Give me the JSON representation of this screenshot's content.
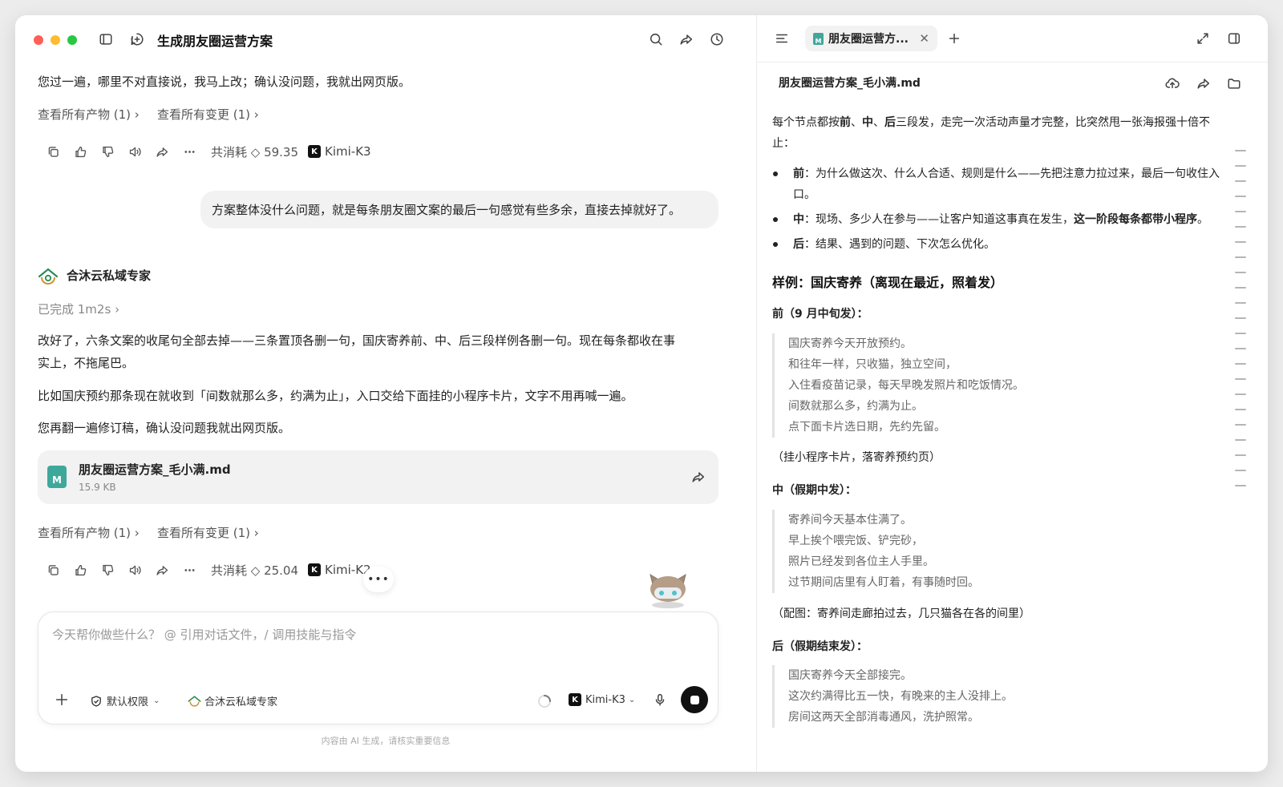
{
  "titlebar": {
    "chat_title": "生成朋友圈运营方案"
  },
  "chat": {
    "intro_line": "您过一遍，哪里不对直接说，我马上改；确认没问题，我就出网页版。",
    "links1": {
      "artifacts": "查看所有产物 (1)",
      "changes": "查看所有变更 (1)"
    },
    "toolbar1": {
      "cost": "共消耗 ◇ 59.35",
      "model": "Kimi-K3"
    },
    "user_message": "方案整体没什么问题，就是每条朋友圈文案的最后一句感觉有些多余，直接去掉就好了。",
    "agent": {
      "name": "合沐云私域专家",
      "status": "已完成 1m2s",
      "para1_line1": "改好了，六条文案的收尾句全部去掉——三条置顶各删一句，国庆寄养前、中、后三段样例各删一句。现在每条都收在事",
      "para1_line2": "实上，不拖尾巴。",
      "para2": "比如国庆预约那条现在就收到「间数就那么多，约满为止」，入口交给下面挂的小程序卡片，文字不用再喊一遍。",
      "para3": "您再翻一遍修订稿，确认没问题我就出网页版。"
    },
    "file_card": {
      "name": "朋友圈运营方案_毛小满.md",
      "size": "15.9 KB",
      "icon_letter": "M"
    },
    "links2": {
      "artifacts": "查看所有产物 (1)",
      "changes": "查看所有变更 (1)"
    },
    "toolbar2": {
      "cost": "共消耗 ◇ 25.04",
      "model": "Kimi-K2"
    },
    "input": {
      "placeholder": "今天帮你做些什么？ @ 引用对话文件，/ 调用技能与指令",
      "permission": "默认权限",
      "agent": "合沐云私域专家",
      "model": "Kimi-K3"
    },
    "disclaimer": "内容由 AI 生成，请核实重要信息"
  },
  "panel": {
    "tab_label": "朋友圈运营方...",
    "doc_title": "朋友圈运营方案_毛小满.md",
    "intro_a": "每个节点都按",
    "intro_b1": "前",
    "intro_b2": "中",
    "intro_b3": "后",
    "intro_c": "三段发，走完一次活动声量才完整，比突然甩一张海报强十倍不",
    "intro_d": "止：",
    "bullets": [
      {
        "key": "前",
        "text": "：为什么做这次、什么人合适、规则是什么——先把注意力拉过来，最后一句收住入",
        "cont": "口。"
      },
      {
        "key": "中",
        "text": "：现场、多少人在参与——让客户知道这事真在发生，",
        "bold_tail": "这一阶段每条都带小程序",
        "end": "。"
      },
      {
        "key": "后",
        "text": "：结果、遇到的问题、下次怎么优化。"
      }
    ],
    "example_heading": "样例：国庆寄养（离现在最近，照着发）",
    "before": {
      "heading": "前（9 月中旬发）：",
      "lines": [
        "国庆寄养今天开放预约。",
        "和往年一样，只收猫，独立空间，",
        "入住看疫苗记录，每天早晚发照片和吃饭情况。",
        "间数就那么多，约满为止。",
        "点下面卡片选日期，先约先留。"
      ],
      "note": "（挂小程序卡片，落寄养预约页）"
    },
    "during": {
      "heading": "中（假期中发）：",
      "lines": [
        "寄养间今天基本住满了。",
        "早上挨个喂完饭、铲完砂，",
        "照片已经发到各位主人手里。",
        "过节期间店里有人盯着，有事随时回。"
      ],
      "note": "（配图：寄养间走廊拍过去，几只猫各在各的间里）"
    },
    "after": {
      "heading": "后（假期结束发）：",
      "lines": [
        "国庆寄养今天全部接完。",
        "这次约满得比五一快，有晚来的主人没排上。",
        "房间这两天全部消毒通风，洗护照常。"
      ]
    }
  },
  "colors": {
    "close": "#ff5f57",
    "minimize": "#febc2e",
    "zoom": "#28c840",
    "file_icon": "#3ea89a"
  }
}
